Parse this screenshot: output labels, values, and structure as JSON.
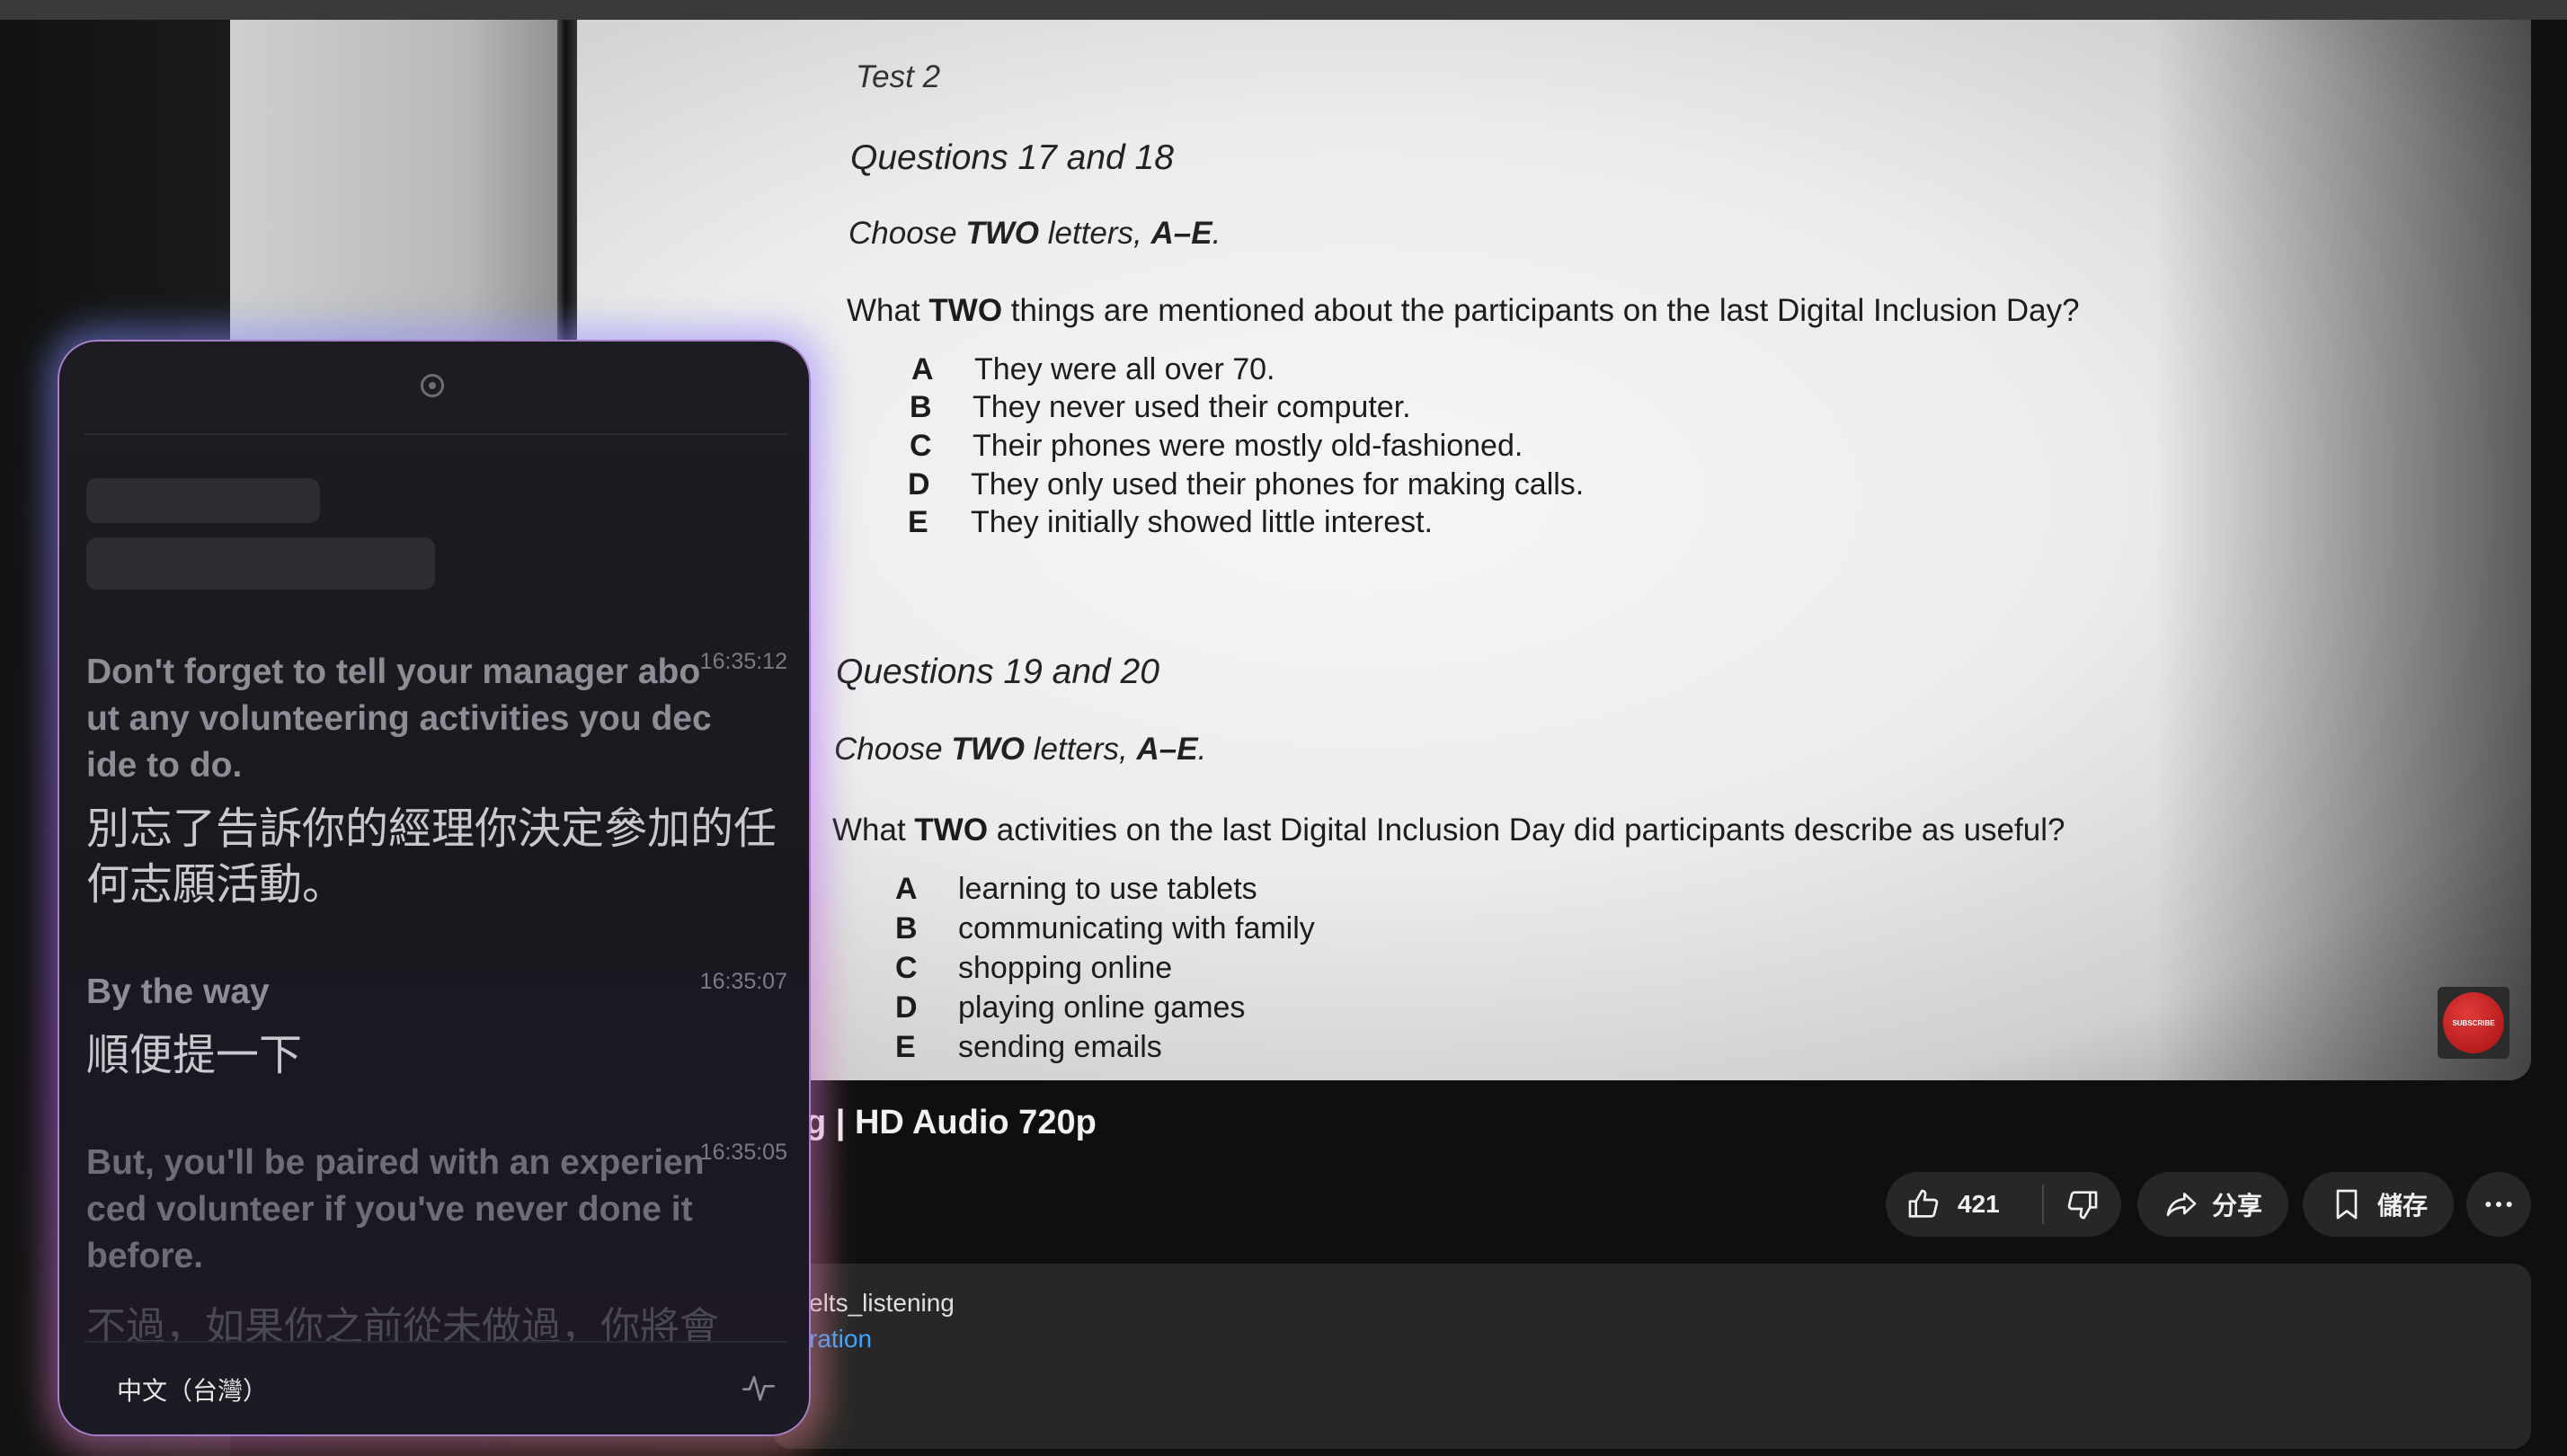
{
  "video": {
    "test_label": "Test 2",
    "section1": {
      "heading": "Questions 17 and 18",
      "instruction_prefix": "Choose ",
      "instruction_bold": "TWO",
      "instruction_mid": " letters, ",
      "instruction_range": "A–E",
      "instruction_end": ".",
      "question_prefix": "What ",
      "question_bold": "TWO",
      "question_rest": " things are mentioned about the participants on the last Digital Inclusion Day?",
      "options": [
        {
          "letter": "A",
          "text": "They were all over 70."
        },
        {
          "letter": "B",
          "text": "They never used their computer."
        },
        {
          "letter": "C",
          "text": "Their phones were mostly old-fashioned."
        },
        {
          "letter": "D",
          "text": "They only used their phones for making calls."
        },
        {
          "letter": "E",
          "text": "They initially showed little interest."
        }
      ]
    },
    "section2": {
      "heading": "Questions 19 and 20",
      "instruction_prefix": "Choose ",
      "instruction_bold": "TWO",
      "instruction_mid": " letters, ",
      "instruction_range": "A–E",
      "instruction_end": ".",
      "question_prefix": "What ",
      "question_bold": "TWO",
      "question_rest": " activities on the last Digital Inclusion Day did participants describe as useful?",
      "options": [
        {
          "letter": "A",
          "text": "learning to use tablets"
        },
        {
          "letter": "B",
          "text": "communicating with family"
        },
        {
          "letter": "C",
          "text": "shopping online"
        },
        {
          "letter": "D",
          "text": "playing online games"
        },
        {
          "letter": "E",
          "text": "sending emails"
        }
      ]
    },
    "subscribe_badge": "SUBSCRIBE"
  },
  "page": {
    "title": "g | HD Audio 720p",
    "like_count": "421",
    "share_label": "分享",
    "save_label": "儲存",
    "description": {
      "channel": "elts_listening",
      "link": "ration"
    }
  },
  "translator": {
    "entries": [
      {
        "time": "16:35:12",
        "en": "Don't forget to tell your manager about any volunteering activities you decide to do.",
        "zh": "別忘了告訴你的經理你決定參加的任何志願活動。"
      },
      {
        "time": "16:35:07",
        "en": "By the way",
        "zh": "順便提一下"
      },
      {
        "time": "16:35:05",
        "en": "But, you'll be paired with an experienced volunteer if you've never done it before.",
        "zh": "不過，如果你之前從未做過，你將會"
      }
    ],
    "language": "中文（台灣）"
  }
}
